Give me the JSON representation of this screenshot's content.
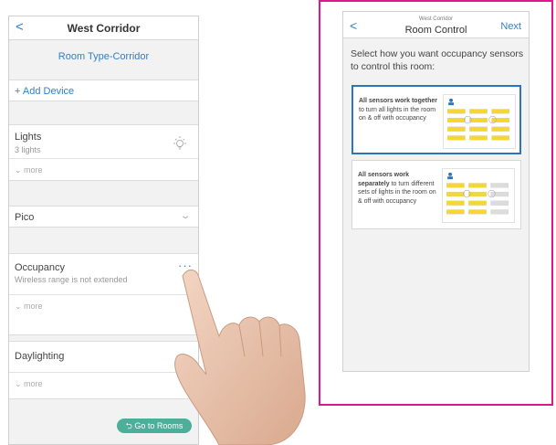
{
  "left": {
    "back": "<",
    "title": "West Corridor",
    "room_type": "Room Type-Corridor",
    "add_device": "+ Add Device",
    "lights_title": "Lights",
    "lights_sub": "3 lights",
    "more": "more",
    "pico": "Pico",
    "occupancy_title": "Occupancy",
    "occupancy_sub": "Wireless range is not extended",
    "occupancy_menu": "···",
    "daylighting": "Daylighting",
    "go_to_rooms": "Go to Rooms"
  },
  "right": {
    "back": "<",
    "subtitle": "West Corridor",
    "title": "Room Control",
    "next": "Next",
    "prompt": "Select how you want occupancy sensors to control this room:",
    "option1_bold": "All sensors work together",
    "option1_rest": " to turn all lights in the room on & off with occupancy",
    "option2_bold": "All sensors work separately",
    "option2_rest": " to turn different sets of lights in the room on & off with occupancy"
  },
  "colors": {
    "accent": "#2f7fc9",
    "frame": "#e0178a",
    "selected": "#2a74c0",
    "go_button": "#4caf9a",
    "light_on": "#f5d733",
    "light_off": "#dcdcdc"
  },
  "icons": [
    "chevron-left-icon",
    "light-bulb-icon",
    "chevron-down-icon",
    "more-dots-icon",
    "return-arrow-icon",
    "person-icon"
  ]
}
